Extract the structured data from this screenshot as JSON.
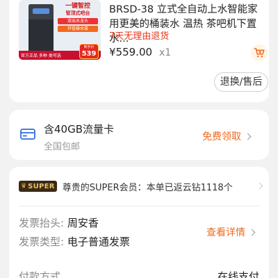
{
  "product": {
    "thumb": {
      "promo_title": "一键智控",
      "promo_title2": "管顶式吧台",
      "tag1": "双出水龙头",
      "tag2": "开低噪水泵",
      "bottom_left": "官方正品 多种 类可选",
      "badge_label": "到手价",
      "badge_price": "539"
    },
    "title": "BRSD-38 立式全自动上水智能家用更美的桶装水 温热 茶吧机下置水...",
    "return_policy": "7天无理由退货",
    "price": "¥559.00",
    "quantity": "x1",
    "refund_button": "退换/售后"
  },
  "data_card": {
    "title": "含40GB流量卡",
    "subtitle": "全国包邮",
    "claim_label": "免费领取"
  },
  "order_info": {
    "super_logo": "SUPER",
    "super_text": "尊贵的SUPER会员：本单已返云钻1118个",
    "invoice_title_label": "发票抬头:",
    "invoice_title_value": "周安香",
    "invoice_type_label": "发票类型:",
    "invoice_type_value": "电子普通发票",
    "detail_link": "查看详情",
    "payment_label": "付款方式",
    "payment_value": "在线支付"
  },
  "colors": {
    "accent": "#f06a1e",
    "return_red": "#e8361a",
    "background": "#f2f2f2"
  }
}
